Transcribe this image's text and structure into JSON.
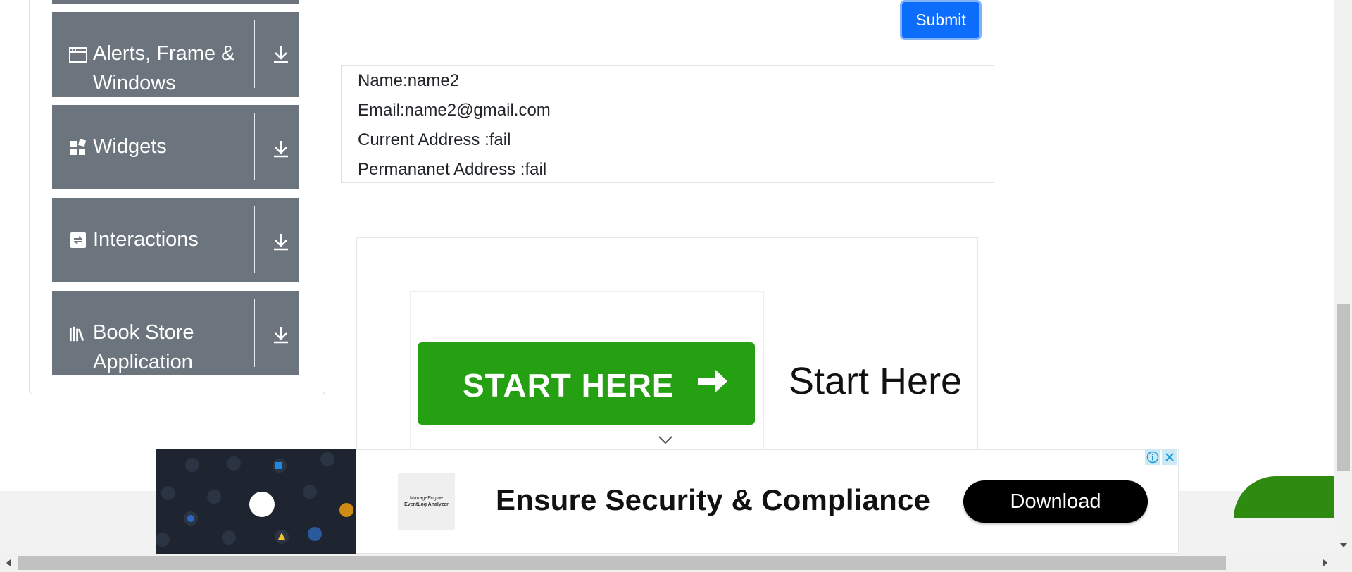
{
  "sidebar": {
    "groups": [
      {
        "label_line1": "Alerts, Frame &",
        "label_line2": "Windows",
        "icon": "window-icon"
      },
      {
        "label_line1": "Widgets",
        "label_line2": "",
        "icon": "widgets-icon"
      },
      {
        "label_line1": "Interactions",
        "label_line2": "",
        "icon": "interactions-icon"
      },
      {
        "label_line1": "Book Store",
        "label_line2": "Application",
        "icon": "books-icon"
      }
    ]
  },
  "form": {
    "submit_label": "Submit"
  },
  "output": {
    "name": "Name:name2",
    "email": "Email:name2@gmail.com",
    "current_address": "Current Address :fail",
    "permanent_address": "Permananet Address :fail"
  },
  "ad_top": {
    "button_label": "START HERE",
    "side_text": "Start Here"
  },
  "ad_banner": {
    "logo_line1": "ManageEngine",
    "logo_line2": "EventLog Analyzer",
    "headline": "Ensure Security & Compliance",
    "cta": "Download"
  },
  "colors": {
    "sidebar_group_bg": "#6c757d",
    "submit_bg": "#0d6efd",
    "start_button_bg": "#24a012"
  }
}
